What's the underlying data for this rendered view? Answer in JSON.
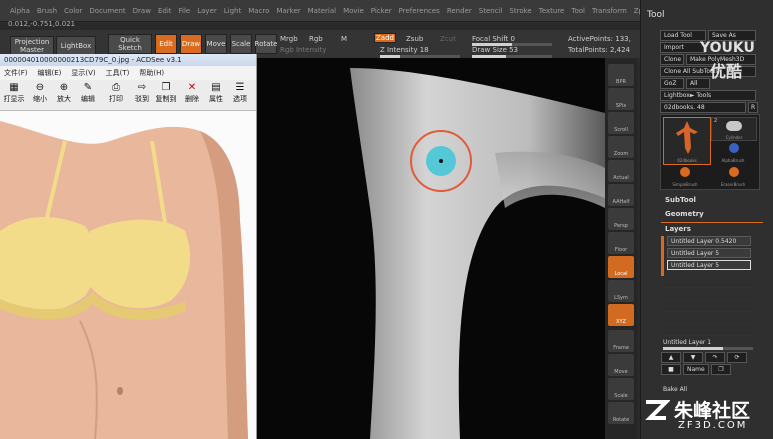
{
  "menu": [
    "Alpha",
    "Brush",
    "Color",
    "Document",
    "Draw",
    "Edit",
    "File",
    "Layer",
    "Light",
    "Macro",
    "Marker",
    "Material",
    "Movie",
    "Picker",
    "Preferences",
    "Render",
    "Stencil",
    "Stroke",
    "Texture",
    "Tool",
    "Transform",
    "Zplugin",
    "Zscript"
  ],
  "coords": "0.012,-0.751,0.021",
  "toolbar": {
    "projection_master": "Projection Master",
    "lightbox": "LightBox",
    "quick_sketch": "Quick Sketch",
    "edit": "Edit",
    "draw": "Draw",
    "move": "Move",
    "scale": "Scale",
    "rotate": "Rotate",
    "mrgb": "Mrgb",
    "rgb": "Rgb",
    "m": "M",
    "rgb_intensity": "Rgb Intensity",
    "zadd": "Zadd",
    "zsub": "Zsub",
    "zcut": "Zcut",
    "z_intensity": "Z Intensity 18",
    "focal_shift": "Focal Shift 0",
    "draw_size": "Draw Size 53",
    "active_points": "ActivePoints: 133,",
    "total_points": "TotalPoints: 2,424"
  },
  "tool_panel": {
    "title": "Tool",
    "load_tool": "Load Tool",
    "save_as": "Save As",
    "import": "Import",
    "clone": "Clone",
    "make_polymesh": "Make PolyMesh3D",
    "clone_all_subtools": "Clone All SubTools",
    "goz": "GoZ",
    "all": "All",
    "lightbox_tools": "Lightbox► Tools",
    "current_tool": "02dbooks. 48",
    "r": "R",
    "thumb_count": "2",
    "thumb_labels": [
      "02dbooks",
      "Cylinder",
      "AlphaBrush",
      "SimpleBrush",
      "EraserBrush"
    ],
    "subtool": "SubTool",
    "geometry": "Geometry",
    "layers": "Layers",
    "layer_items": [
      "Untitled Layer 0.5420",
      "Untitled Layer 5",
      "Untitled Layer 5"
    ],
    "layer_name": "Untitled Layer 1",
    "name": "Name",
    "bake_all": "Bake All"
  },
  "right_toolbar": [
    "BPR",
    "SPix",
    "Scroll",
    "Zoom",
    "Actual",
    "AAHalf",
    "Persp",
    "Floor",
    "Local",
    "LSym",
    "XYZ",
    "Frame",
    "Move",
    "Scale",
    "Rotate"
  ],
  "viewer": {
    "title": "000004010000000213CD79C_0.jpg - ACDSee v3.1",
    "menu": [
      "文件(F)",
      "编辑(E)",
      "显示(V)",
      "工具(T)",
      "帮助(H)"
    ],
    "buttons": [
      "打显示",
      "缩小",
      "放大",
      "编辑",
      "打印",
      "驳到",
      "复制到",
      "删除",
      "属性",
      "选项"
    ]
  },
  "watermarks": {
    "youku": "YOUKU",
    "youku_cn": "优酷",
    "site": "朱峰社区",
    "url": "ZF3D.COM"
  }
}
